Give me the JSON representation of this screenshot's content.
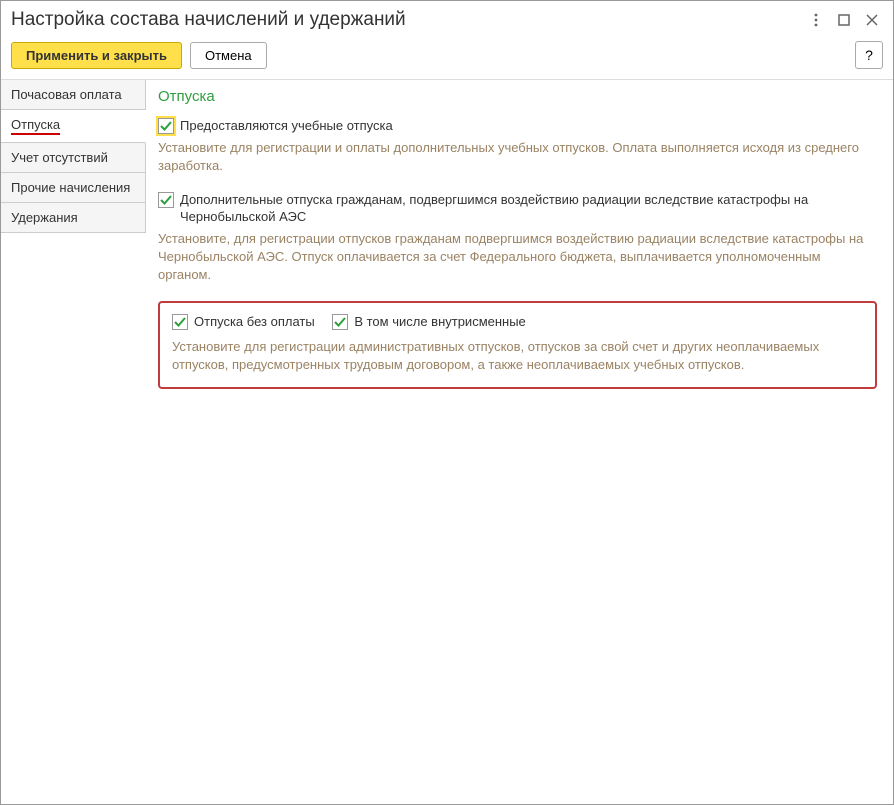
{
  "window": {
    "title": "Настройка состава начислений и удержаний"
  },
  "toolbar": {
    "apply_close": "Применить и закрыть",
    "cancel": "Отмена",
    "help": "?"
  },
  "sidebar": {
    "items": [
      {
        "label": "Почасовая оплата"
      },
      {
        "label": "Отпуска"
      },
      {
        "label": "Учет отсутствий"
      },
      {
        "label": "Прочие начисления"
      },
      {
        "label": "Удержания"
      }
    ]
  },
  "content": {
    "heading": "Отпуска",
    "opt1": {
      "label": "Предоставляются учебные отпуска",
      "hint": "Установите для регистрации и оплаты дополнительных учебных отпусков. Оплата выполняется исходя из среднего заработка."
    },
    "opt2": {
      "label": "Дополнительные отпуска гражданам, подвергшимся воздействию радиации вследствие катастрофы на Чернобыльской АЭС",
      "hint": "Установите, для регистрации отпусков гражданам подвергшимся воздействию радиации вследствие катастрофы на Чернобыльской АЭС. Отпуск оплачивается за счет Федерального бюджета, выплачивается уполномоченным органом."
    },
    "opt3": {
      "label": "Отпуска без оплаты"
    },
    "opt4": {
      "label": "В том числе внутрисменные"
    },
    "opt3_hint": "Установите для регистрации административных отпусков, отпусков за свой счет и других неоплачиваемых отпусков, предусмотренных трудовым договором, а также неоплачиваемых учебных отпусков."
  }
}
